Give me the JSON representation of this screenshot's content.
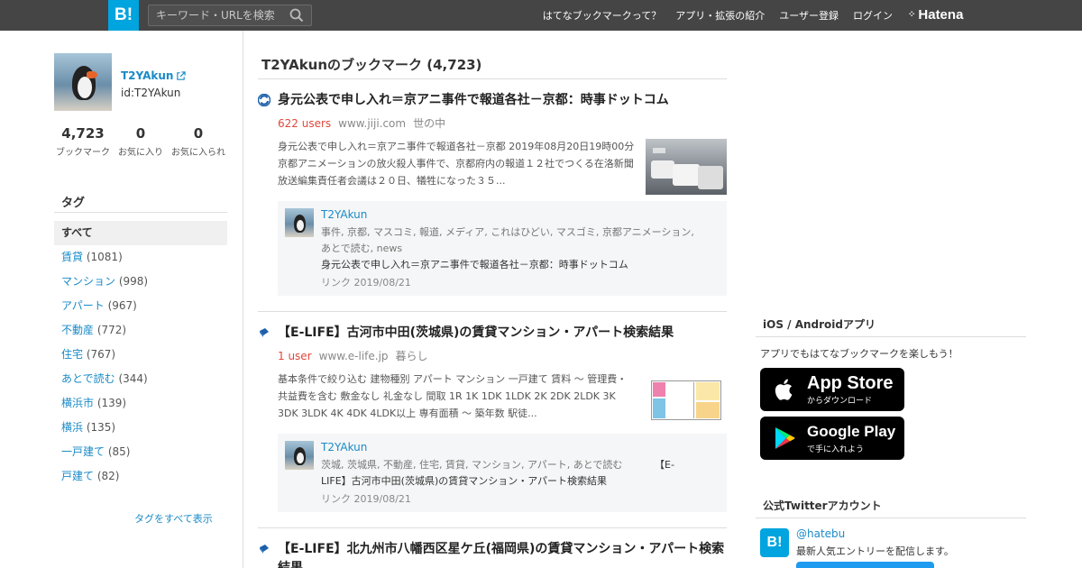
{
  "header": {
    "logo_text": "B!",
    "search_placeholder": "キーワード・URLを検索",
    "nav": [
      "はてなブックマークって？",
      "アプリ・拡張の紹介",
      "ユーザー登録",
      "ログイン"
    ],
    "brand": "Hatena"
  },
  "profile": {
    "username": "T2YAkun",
    "id": "id:T2YAkun",
    "stats": [
      {
        "value": "4,723",
        "label": "ブックマーク"
      },
      {
        "value": "0",
        "label": "お気に入り"
      },
      {
        "value": "0",
        "label": "お気に入られ"
      }
    ]
  },
  "tags": {
    "heading": "タグ",
    "items": [
      {
        "name": "すべて",
        "count": ""
      },
      {
        "name": "賃貸",
        "count": "(1081)"
      },
      {
        "name": "マンション",
        "count": "(998)"
      },
      {
        "name": "アパート",
        "count": "(967)"
      },
      {
        "name": "不動産",
        "count": "(772)"
      },
      {
        "name": "住宅",
        "count": "(767)"
      },
      {
        "name": "あとで読む",
        "count": "(344)"
      },
      {
        "name": "横浜市",
        "count": "(139)"
      },
      {
        "name": "横浜",
        "count": "(135)"
      },
      {
        "name": "一戸建て",
        "count": "(85)"
      },
      {
        "name": "戸建て",
        "count": "(82)"
      }
    ],
    "show_all": "タグをすべて表示"
  },
  "main": {
    "title": "T2YAkunのブックマーク (4,723)",
    "entries": [
      {
        "title": "身元公表で申し入れ＝京アニ事件で報道各社－京都：時事ドットコム",
        "users": "622 users",
        "domain": "www.jiji.com",
        "category": "世の中",
        "description": "身元公表で申し入れ＝京アニ事件で報道各社－京都 2019年08月20日19時00分 京都アニメーションの放火殺人事件で、京都府内の報道１２社でつくる在洛新聞放送編集責任者会議は２０日、犠牲になった３５...",
        "comment": {
          "user": "T2YAkun",
          "tags": "事件, 京都, マスコミ, 報道, メディア, これはひどい, マスゴミ, 京都アニメーション, あとで読む, news",
          "text": "身元公表で申し入れ＝京アニ事件で報道各社－京都：時事ドットコム",
          "link": "リンク 2019/08/21"
        }
      },
      {
        "title": "【E-LIFE】古河市中田(茨城県)の賃貸マンション・アパート検索結果",
        "users": "1 user",
        "domain": "www.e-life.jp",
        "category": "暮らし",
        "description": "基本条件で絞り込む 建物種別 アパート マンション 一戸建て 賃料 〜 管理費・共益費を含む 敷金なし 礼金なし 間取 1R 1K 1DK 1LDK 2K 2DK 2LDK 3K 3DK 3LDK 4K 4DK 4LDK以上 専有面積 〜 築年数 駅徒...",
        "comment": {
          "user": "T2YAkun",
          "tags": "茨城, 茨城県, 不動産, 住宅, 賃貸, マンション, アパート, あとで読む",
          "text": "【E-LIFE】古河市中田(茨城県)の賃貸マンション・アパート検索結果",
          "link": "リンク 2019/08/21"
        }
      },
      {
        "title": "【E-LIFE】北九州市八幡西区星ケ丘(福岡県)の賃貸マンション・アパート検索結果"
      }
    ]
  },
  "right": {
    "app_heading": "iOS / Androidアプリ",
    "app_desc": "アプリでもはてなブックマークを楽しもう！",
    "app_store": {
      "big": "App Store",
      "small": "からダウンロード"
    },
    "google_play": {
      "big": "Google Play",
      "small": "で手に入れよう"
    },
    "twitter_heading": "公式Twitterアカウント",
    "twitter_logo": "B!",
    "twitter_handle": "@hatebu",
    "twitter_desc": "最新人気エントリーを配信します。"
  },
  "colors": {
    "brand": "#00a4de",
    "header_bg": "#454545",
    "link": "#1a8bc7",
    "users_red": "#e0483a"
  }
}
